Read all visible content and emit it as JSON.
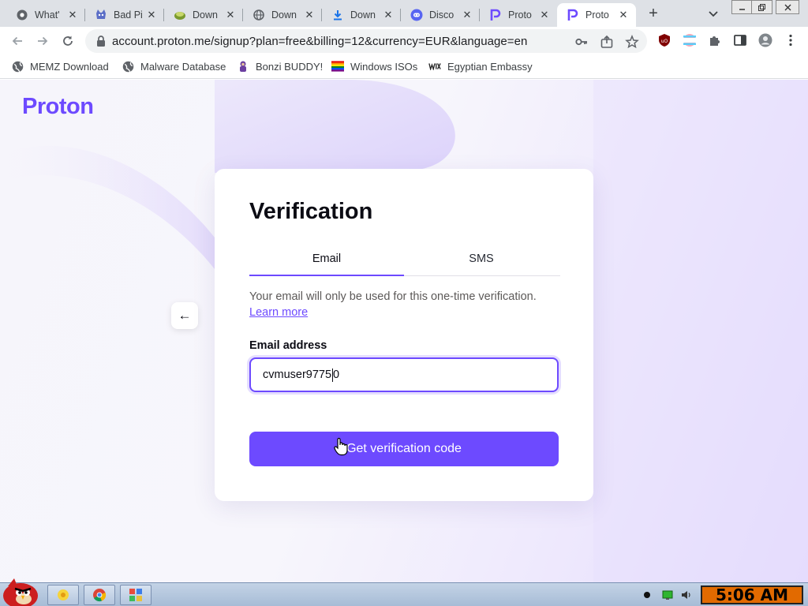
{
  "browser": {
    "tabs": [
      {
        "label": "What'",
        "icon": "chrome-icon"
      },
      {
        "label": "Bad Pi",
        "icon": "cartoon-icon"
      },
      {
        "label": "Down",
        "icon": "greenlogo-icon"
      },
      {
        "label": "Down",
        "icon": "globe-icon"
      },
      {
        "label": "Down",
        "icon": "download-icon"
      },
      {
        "label": "Disco",
        "icon": "discord-icon"
      },
      {
        "label": "Proto",
        "icon": "proton-icon"
      },
      {
        "label": "Proto",
        "icon": "proton-icon",
        "active": true
      }
    ],
    "new_tab_label": "+",
    "close_glyph": "✕",
    "url": "account.proton.me/signup?plan=free&billing=12&currency=EUR&language=en"
  },
  "bookmarks": [
    {
      "label": "MEMZ Download",
      "icon": "globe-icon"
    },
    {
      "label": "Malware Database",
      "icon": "globe-icon"
    },
    {
      "label": "Bonzi BUDDY!",
      "icon": "bonzi-icon"
    },
    {
      "label": "Windows ISOs",
      "icon": "rainbow-flag-icon"
    },
    {
      "label": "Egyptian Embassy",
      "icon": "wix-icon"
    }
  ],
  "page": {
    "logo": "Proton",
    "back_glyph": "←",
    "title": "Verification",
    "tabs": {
      "email": "Email",
      "sms": "SMS"
    },
    "hint": "Your email will only be used for this one-time verification.",
    "learn_more": "Learn more",
    "email_label": "Email address",
    "email_value_before_caret": "cvmuser9775",
    "email_value_after_caret": "0",
    "submit_label": "Get verification code"
  },
  "taskbar": {
    "clock": "5:06 AM"
  },
  "colors": {
    "accent": "#6d4aff",
    "tabstrip": "#dee1e6",
    "clock_bg": "#e26a00"
  }
}
